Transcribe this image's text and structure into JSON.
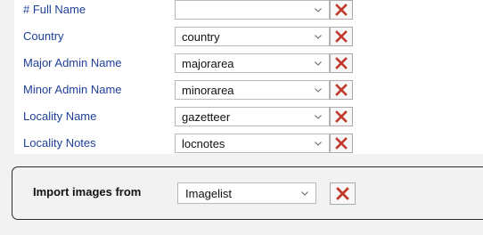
{
  "mappings": [
    {
      "label": "# Full Name",
      "value": ""
    },
    {
      "label": "Country",
      "value": "country"
    },
    {
      "label": "Major Admin Name",
      "value": "majorarea"
    },
    {
      "label": "Minor Admin Name",
      "value": "minorarea"
    },
    {
      "label": "Locality Name",
      "value": "gazetteer"
    },
    {
      "label": "Locality Notes",
      "value": "locnotes"
    }
  ],
  "import_images": {
    "label": "Import images from",
    "value": "Imagelist"
  },
  "colors": {
    "label_text": "#1f3f99",
    "delete_x": "#c0392b",
    "panel_bg": "#ffffff",
    "page_bg": "#f2f2f2"
  },
  "icons": {
    "dropdown": "chevron-down-icon",
    "delete": "red-x-icon"
  }
}
